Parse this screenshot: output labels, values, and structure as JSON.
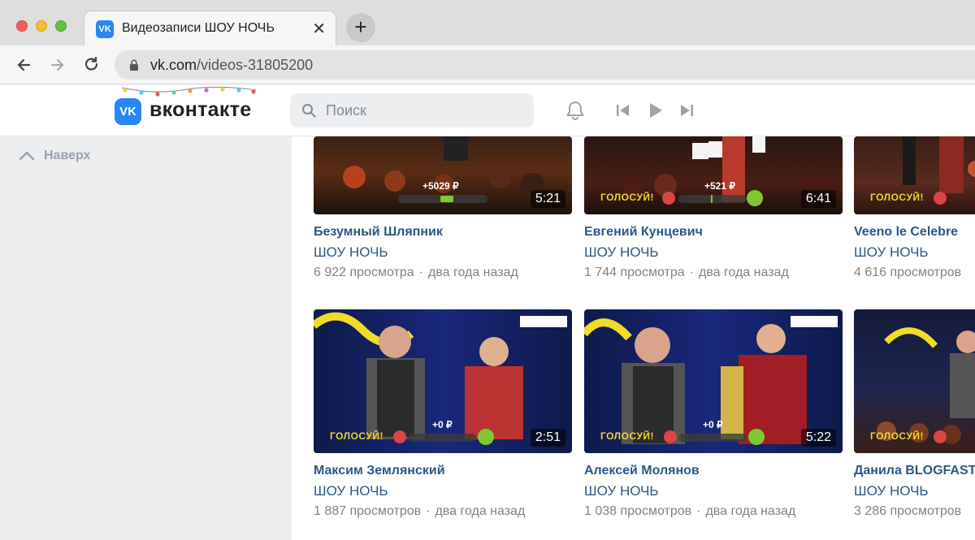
{
  "browser": {
    "tab_title": "Видеозаписи ШОУ НОЧЬ",
    "tab_close": "✕",
    "new_tab": "+",
    "url_host": "vk.com",
    "url_path": "/videos-31805200"
  },
  "header": {
    "logo_text": "VK",
    "wordmark": "вконтакте",
    "search_placeholder": "Поиск"
  },
  "sidebar": {
    "to_top_label": "Наверх"
  },
  "videos": [
    {
      "title": "Безумный Шляпник",
      "owner": "ШОУ НОЧЬ",
      "views": "6 922 просмотра",
      "ago": "два года назад",
      "duration": "5:21",
      "overlay": "+5029 ₽"
    },
    {
      "title": "Евгений Кунцевич",
      "owner": "ШОУ НОЧЬ",
      "views": "1 744 просмотра",
      "ago": "два года назад",
      "duration": "6:41",
      "overlay": "+521 ₽"
    },
    {
      "title": "Veeno le Celebre",
      "owner": "ШОУ НОЧЬ",
      "views": "4 616 просмотров",
      "ago": "",
      "duration": "",
      "overlay": ""
    },
    {
      "title": "Максим Землянский",
      "owner": "ШОУ НОЧЬ",
      "views": "1 887 просмотров",
      "ago": "два года назад",
      "duration": "2:51",
      "overlay": "+0 ₽"
    },
    {
      "title": "Алексей Молянов",
      "owner": "ШОУ НОЧЬ",
      "views": "1 038 просмотров",
      "ago": "два года назад",
      "duration": "5:22",
      "overlay": "+0 ₽"
    },
    {
      "title": "Данила BLOGFAST",
      "owner": "ШОУ НОЧЬ",
      "views": "3 286 просмотров",
      "ago": "",
      "duration": "",
      "overlay": ""
    }
  ],
  "overlay_text": {
    "vote": "ГОЛОСУЙ!"
  },
  "colors": {
    "vk_blue": "#2787f5",
    "link": "#2a5885",
    "meta": "#828282",
    "sidebar_bg": "#edeef0"
  }
}
